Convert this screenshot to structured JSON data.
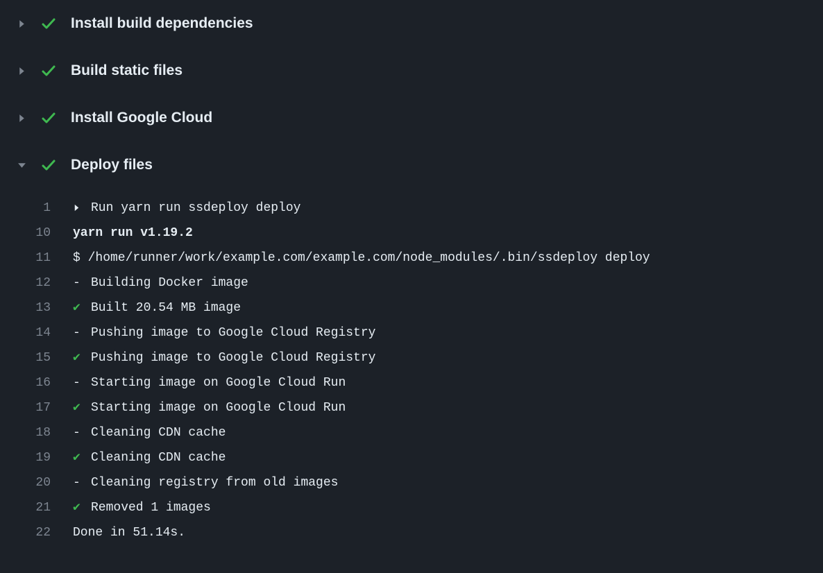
{
  "steps": [
    {
      "title": "Install build dependencies",
      "expanded": false
    },
    {
      "title": "Build static files",
      "expanded": false
    },
    {
      "title": "Install Google Cloud",
      "expanded": false
    },
    {
      "title": "Deploy files",
      "expanded": true
    }
  ],
  "log_lines": [
    {
      "n": "1",
      "prefix": "chevron",
      "text": "Run yarn run ssdeploy deploy",
      "bold": false
    },
    {
      "n": "10",
      "prefix": "",
      "text": "yarn run v1.19.2",
      "bold": true
    },
    {
      "n": "11",
      "prefix": "",
      "text": "$ /home/runner/work/example.com/example.com/node_modules/.bin/ssdeploy deploy",
      "bold": false
    },
    {
      "n": "12",
      "prefix": "dash",
      "text": "Building Docker image",
      "bold": false
    },
    {
      "n": "13",
      "prefix": "tick",
      "text": "Built 20.54 MB image",
      "bold": false
    },
    {
      "n": "14",
      "prefix": "dash",
      "text": "Pushing image to Google Cloud Registry",
      "bold": false
    },
    {
      "n": "15",
      "prefix": "tick",
      "text": "Pushing image to Google Cloud Registry",
      "bold": false
    },
    {
      "n": "16",
      "prefix": "dash",
      "text": "Starting image on Google Cloud Run",
      "bold": false
    },
    {
      "n": "17",
      "prefix": "tick",
      "text": "Starting image on Google Cloud Run",
      "bold": false
    },
    {
      "n": "18",
      "prefix": "dash",
      "text": "Cleaning CDN cache",
      "bold": false
    },
    {
      "n": "19",
      "prefix": "tick",
      "text": "Cleaning CDN cache",
      "bold": false
    },
    {
      "n": "20",
      "prefix": "dash",
      "text": "Cleaning registry from old images",
      "bold": false
    },
    {
      "n": "21",
      "prefix": "tick",
      "text": "Removed 1 images",
      "bold": false
    },
    {
      "n": "22",
      "prefix": "",
      "text": "Done in 51.14s.",
      "bold": false
    }
  ]
}
